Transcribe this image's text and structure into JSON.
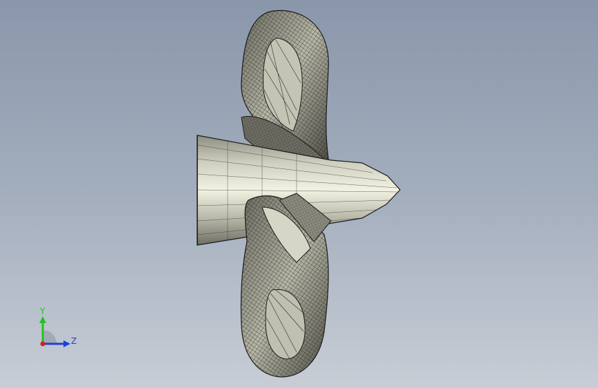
{
  "viewport": {
    "background_top": "#8a97ab",
    "background_bottom": "#c8cdd6"
  },
  "model": {
    "icon": "propeller-wireframe-model",
    "style": "shaded-with-edges",
    "edge_color": "#1a1a1a",
    "face_light": "#eeeede",
    "face_mid": "#a8a89a",
    "face_dark": "#4a4a42"
  },
  "triad": {
    "y_label": "Y",
    "z_label": "Z",
    "y_color": "#22c322",
    "z_color": "#1f3fd8",
    "x_color": "#d42020"
  }
}
